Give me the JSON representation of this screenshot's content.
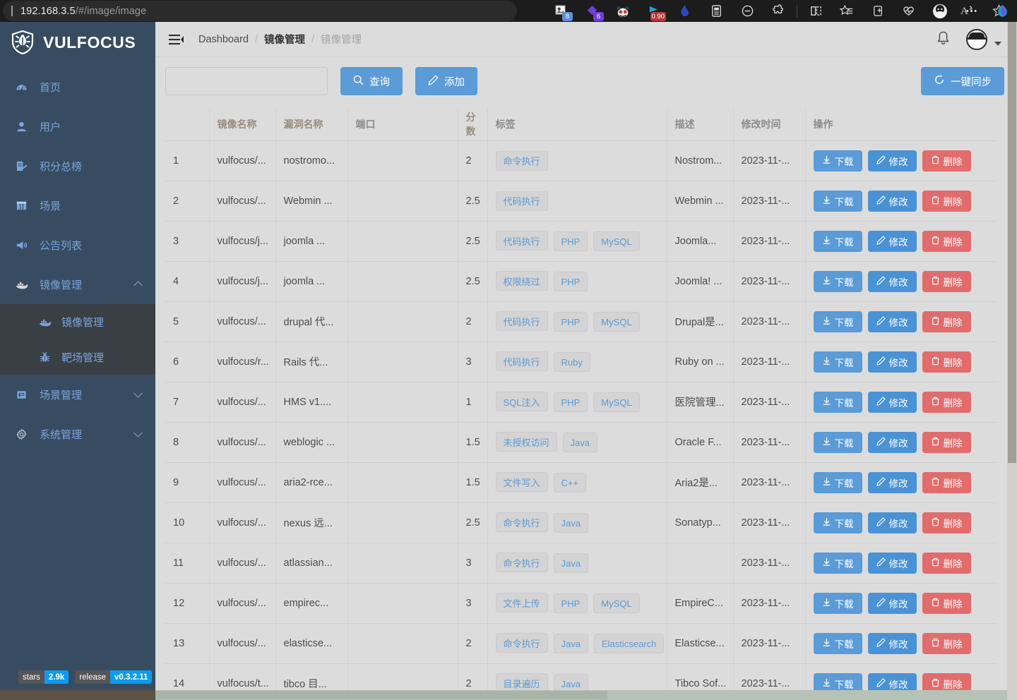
{
  "browser": {
    "url_host": "192.168.3.5",
    "url_path": "/#/image/image",
    "read_aloud_icon": "read-aloud-icon",
    "favorite_icon": "star-icon",
    "extensions": [
      {
        "name": "collections-extension-icon",
        "badge": "8",
        "badge_color": "#5b8fd9"
      },
      {
        "name": "diamond-extension-icon",
        "badge": "6",
        "badge_color": "#6f3fd6"
      },
      {
        "name": "panda-extension-icon",
        "badge": "",
        "badge_color": ""
      },
      {
        "name": "speed-extension-icon",
        "badge": "0.90",
        "badge_color": "#b5383c"
      },
      {
        "name": "wave-extension-icon",
        "badge": "",
        "badge_color": ""
      },
      {
        "name": "reading-list-icon",
        "badge": "",
        "badge_color": ""
      },
      {
        "name": "minus-circle-icon",
        "badge": "",
        "badge_color": ""
      },
      {
        "name": "puzzle-extensions-icon",
        "badge": "",
        "badge_color": ""
      },
      {
        "name": "split-screen-icon",
        "badge": "",
        "badge_color": ""
      },
      {
        "name": "favorites-add-icon",
        "badge": "",
        "badge_color": ""
      },
      {
        "name": "collections-icon",
        "badge": "",
        "badge_color": ""
      },
      {
        "name": "browser-essentials-icon",
        "badge": "",
        "badge_color": ""
      },
      {
        "name": "profile-avatar-icon",
        "badge": "",
        "badge_color": ""
      },
      {
        "name": "settings-more-icon",
        "badge": "",
        "badge_color": ""
      },
      {
        "name": "copilot-icon",
        "badge": "",
        "badge_color": ""
      }
    ]
  },
  "sidebar": {
    "brand": "VULFOCUS",
    "items": [
      {
        "label": "首页",
        "icon": "dashboard-icon",
        "caret": ""
      },
      {
        "label": "用户",
        "icon": "user-icon",
        "caret": ""
      },
      {
        "label": "积分总榜",
        "icon": "ranking-icon",
        "caret": ""
      },
      {
        "label": "场景",
        "icon": "grid-icon",
        "caret": ""
      },
      {
        "label": "公告列表",
        "icon": "megaphone-icon",
        "caret": ""
      },
      {
        "label": "镜像管理",
        "icon": "docker-icon",
        "caret": "up"
      }
    ],
    "submenu": [
      {
        "label": "镜像管理",
        "icon": "docker-icon",
        "active": true
      },
      {
        "label": "靶场管理",
        "icon": "bug-icon",
        "active": false
      }
    ],
    "items_after": [
      {
        "label": "场景管理",
        "icon": "scene-icon",
        "caret": "down"
      },
      {
        "label": "系统管理",
        "icon": "gear-icon",
        "caret": "down"
      }
    ],
    "badges": [
      {
        "key": "stars",
        "value": "2.9k"
      },
      {
        "key": "release",
        "value": "v0.3.2.11"
      }
    ]
  },
  "header": {
    "menu_toggle_icon": "hamburger-icon",
    "breadcrumb": [
      "Dashboard",
      "镜像管理",
      "镜像管理"
    ],
    "separator": "/",
    "bell_icon": "bell-icon",
    "avatar_icon": "avatar",
    "caret_icon": "chevron-down-icon"
  },
  "toolbar": {
    "search_value": "",
    "search_placeholder": "",
    "query_label": "查询",
    "query_icon": "search-icon",
    "add_label": "添加",
    "add_icon": "edit-pencil-icon",
    "sync_label": "一键同步",
    "sync_icon": "refresh-icon"
  },
  "table": {
    "columns": [
      "",
      "镜像名称",
      "漏洞名称",
      "端口",
      "分数",
      "标签",
      "描述",
      "修改时间",
      "操作"
    ],
    "actions": {
      "download": "下载",
      "download_icon": "download-icon",
      "edit": "修改",
      "edit_icon": "edit-pencil-icon",
      "delete": "删除",
      "delete_icon": "trash-icon"
    },
    "rows": [
      {
        "no": "1",
        "image": "vulfocus/...",
        "vuln": "nostromo...",
        "port": "",
        "score": "2",
        "tags": [
          "命令执行"
        ],
        "desc": "Nostrom...",
        "time": "2023-11-..."
      },
      {
        "no": "2",
        "image": "vulfocus/...",
        "vuln": "Webmin ...",
        "port": "",
        "score": "2.5",
        "tags": [
          "代码执行"
        ],
        "desc": "Webmin ...",
        "time": "2023-11-..."
      },
      {
        "no": "3",
        "image": "vulfocus/j...",
        "vuln": "joomla ...",
        "port": "",
        "score": "2.5",
        "tags": [
          "代码执行",
          "PHP",
          "MySQL"
        ],
        "desc": "Joomla...",
        "time": "2023-11-..."
      },
      {
        "no": "4",
        "image": "vulfocus/j...",
        "vuln": "joomla ...",
        "port": "",
        "score": "2.5",
        "tags": [
          "权限绕过",
          "PHP"
        ],
        "desc": "Joomla! ...",
        "time": "2023-11-..."
      },
      {
        "no": "5",
        "image": "vulfocus/...",
        "vuln": "drupal 代...",
        "port": "",
        "score": "2",
        "tags": [
          "代码执行",
          "PHP",
          "MySQL"
        ],
        "desc": "Drupal是...",
        "time": "2023-11-..."
      },
      {
        "no": "6",
        "image": "vulfocus/r...",
        "vuln": "Rails 代...",
        "port": "",
        "score": "3",
        "tags": [
          "代码执行",
          "Ruby"
        ],
        "desc": "Ruby on ...",
        "time": "2023-11-..."
      },
      {
        "no": "7",
        "image": "vulfocus/...",
        "vuln": "HMS v1....",
        "port": "",
        "score": "1",
        "tags": [
          "SQL注入",
          "PHP",
          "MySQL"
        ],
        "desc": "医院管理...",
        "time": "2023-11-..."
      },
      {
        "no": "8",
        "image": "vulfocus/...",
        "vuln": "weblogic ...",
        "port": "",
        "score": "1.5",
        "tags": [
          "未授权访问",
          "Java"
        ],
        "desc": "Oracle F...",
        "time": "2023-11-..."
      },
      {
        "no": "9",
        "image": "vulfocus/...",
        "vuln": "aria2-rce...",
        "port": "",
        "score": "1.5",
        "tags": [
          "文件写入",
          "C++"
        ],
        "desc": "Aria2是...",
        "time": "2023-11-..."
      },
      {
        "no": "10",
        "image": "vulfocus/...",
        "vuln": "nexus 远...",
        "port": "",
        "score": "2.5",
        "tags": [
          "命令执行",
          "Java"
        ],
        "desc": "Sonatyp...",
        "time": "2023-11-..."
      },
      {
        "no": "11",
        "image": "vulfocus/...",
        "vuln": "atlassian...",
        "port": "",
        "score": "3",
        "tags": [
          "命令执行",
          "Java"
        ],
        "desc": "",
        "time": "2023-11-..."
      },
      {
        "no": "12",
        "image": "vulfocus/...",
        "vuln": "empirec...",
        "port": "",
        "score": "3",
        "tags": [
          "文件上传",
          "PHP",
          "MySQL"
        ],
        "desc": "EmpireC...",
        "time": "2023-11-..."
      },
      {
        "no": "13",
        "image": "vulfocus/...",
        "vuln": "elasticse...",
        "port": "",
        "score": "2",
        "tags": [
          "命令执行",
          "Java",
          "Elasticsearch"
        ],
        "desc": "Elasticse...",
        "time": "2023-11-..."
      },
      {
        "no": "14",
        "image": "vulfocus/t...",
        "vuln": "tibco 目...",
        "port": "",
        "score": "2",
        "tags": [
          "目录遍历",
          "Java"
        ],
        "desc": "Tibco Sof...",
        "time": "2023-11-..."
      }
    ]
  },
  "colors": {
    "sidebar_bg": "#384c61",
    "submenu_bg": "#3a3f44",
    "accent_blue": "#5a9bd8",
    "danger_red": "#e26c6c",
    "tag_text": "#5b9ad6",
    "page_bg": "#dcdcdc"
  }
}
